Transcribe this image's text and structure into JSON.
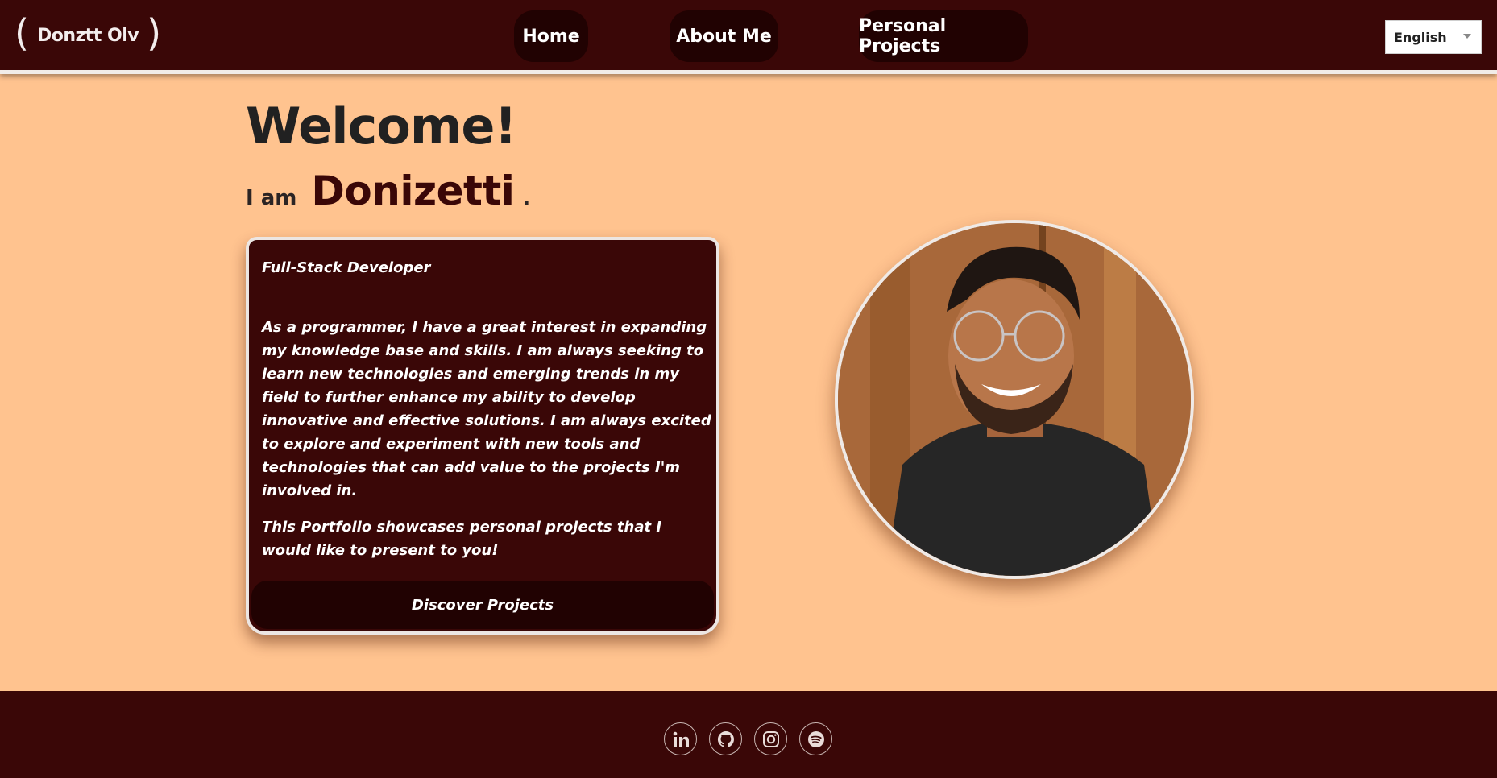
{
  "header": {
    "logo_text": "Donztt Olv",
    "logo_open": "(",
    "logo_close": ")",
    "nav": {
      "home": "Home",
      "about": "About Me",
      "projects": "Personal Projects"
    },
    "language_select": {
      "selected": "English"
    }
  },
  "hero": {
    "welcome": "Welcome!",
    "intro_label": "I am",
    "name": "Donizetti",
    "dot": "."
  },
  "card": {
    "role": "Full-Stack Developer",
    "paragraph1": "As a programmer, I have a great interest in expanding my knowledge base and skills. I am always seeking to learn new technologies and emerging trends in my field to further enhance my ability to develop innovative and effective solutions. I am always excited to explore and experiment with new tools and technologies that can add value to the projects I'm involved in.",
    "paragraph2": "This Portfolio showcases personal projects that I would like to present to you!",
    "cta_label": "Discover Projects"
  },
  "footer": {
    "social_icons": [
      "linkedin-icon",
      "github-icon",
      "instagram-icon",
      "spotify-icon"
    ]
  },
  "colors": {
    "header_bg": "#3a0707",
    "page_bg": "#ffc38f",
    "button_bg": "#210202",
    "text_dark": "#212121"
  }
}
